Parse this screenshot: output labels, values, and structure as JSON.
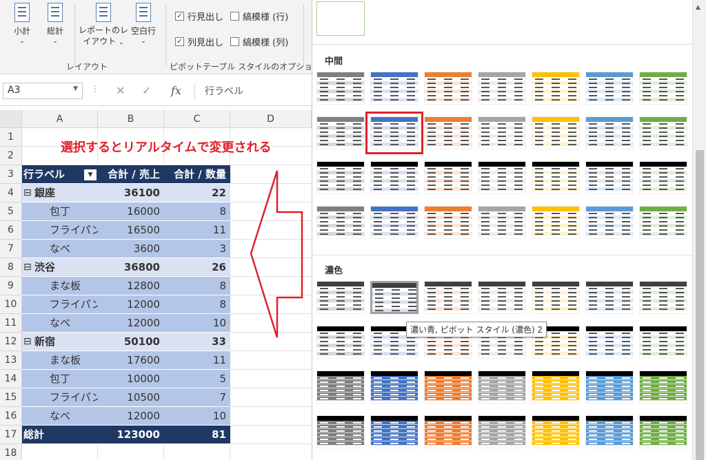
{
  "ribbon": {
    "subtotal": "小計",
    "grandtotal": "総計",
    "report_layout_1": "レポートのレ",
    "report_layout_2": "イアウト",
    "blank_rows": "空白行",
    "group_layout": "レイアウト",
    "opt_row_headers": "行見出し",
    "opt_banded_rows": "縞模様 (行)",
    "opt_col_headers": "列見出し",
    "opt_banded_cols": "縞模様 (列)",
    "group_style_options": "ピボットテーブル スタイルのオプション",
    "chevron": "⌄"
  },
  "formula_bar": {
    "name_box": "A3",
    "formula": "行ラベル",
    "fx": "fx",
    "cancel": "✕",
    "enter": "✓"
  },
  "sheet": {
    "columns": [
      "A",
      "B",
      "C",
      "D"
    ],
    "rows": [
      "1",
      "2",
      "3",
      "4",
      "5",
      "6",
      "7",
      "8",
      "9",
      "10",
      "11",
      "12",
      "13",
      "14",
      "15",
      "16",
      "17",
      "18"
    ],
    "annotation": "選択するとリアルタイムで変更される",
    "pivot_headers": [
      "行ラベル",
      "合計 / 売上",
      "合計 / 数量"
    ],
    "pivot_rows": [
      {
        "label": "銀座",
        "sales": "36100",
        "qty": "22",
        "level": "group"
      },
      {
        "label": "包丁",
        "sales": "16000",
        "qty": "8",
        "level": "item"
      },
      {
        "label": "フライパン",
        "sales": "16500",
        "qty": "11",
        "level": "item"
      },
      {
        "label": "なべ",
        "sales": "3600",
        "qty": "3",
        "level": "item"
      },
      {
        "label": "渋谷",
        "sales": "36800",
        "qty": "26",
        "level": "group"
      },
      {
        "label": "まな板",
        "sales": "12800",
        "qty": "8",
        "level": "item"
      },
      {
        "label": "フライパン",
        "sales": "12000",
        "qty": "8",
        "level": "item"
      },
      {
        "label": "なべ",
        "sales": "12000",
        "qty": "10",
        "level": "item"
      },
      {
        "label": "新宿",
        "sales": "50100",
        "qty": "33",
        "level": "group"
      },
      {
        "label": "まな板",
        "sales": "17600",
        "qty": "11",
        "level": "item"
      },
      {
        "label": "包丁",
        "sales": "10000",
        "qty": "5",
        "level": "item"
      },
      {
        "label": "フライパン",
        "sales": "10500",
        "qty": "7",
        "level": "item"
      },
      {
        "label": "なべ",
        "sales": "12000",
        "qty": "10",
        "level": "item"
      }
    ],
    "total": {
      "label": "総計",
      "sales": "123000",
      "qty": "81"
    },
    "collapse_glyph": "⊟"
  },
  "gallery": {
    "section_medium": "中間",
    "section_dark": "濃色",
    "tooltip": "濃い青, ピボット スタイル (濃色) 2",
    "palette": [
      "#7f7f7f",
      "#4472c4",
      "#ed7d31",
      "#a5a5a5",
      "#ffc000",
      "#5b9bd5",
      "#70ad47"
    ],
    "light": [
      "#d9d9d9",
      "#d9e1f2",
      "#fce4d6",
      "#ededed",
      "#fff2cc",
      "#ddebf7",
      "#e2efda"
    ]
  },
  "colors": {
    "pivot_header": "#1f3864",
    "pivot_group": "#d9e1f2",
    "pivot_item": "#b4c6e7",
    "annotation": "#e0202a",
    "highlight": "#e0202a"
  }
}
